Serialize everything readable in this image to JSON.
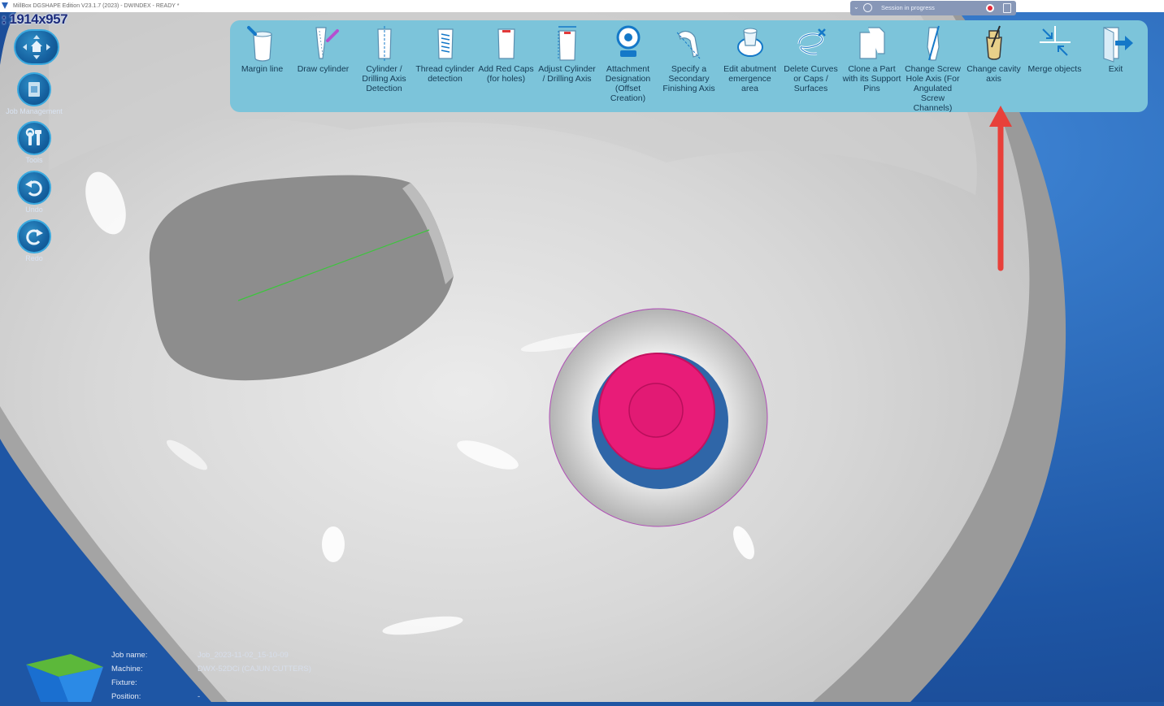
{
  "window": {
    "title": "MillBox DGSHAPE Edition V23.1.7 (2023) - DWINDEX - READY *",
    "resolution_badge": ": 1914x957"
  },
  "session": {
    "text": "Session in progress",
    "icons": [
      "chevron-down-icon",
      "session-icon",
      "record-icon",
      "exit-session-icon"
    ]
  },
  "left_panel": {
    "items": [
      {
        "label": "",
        "icon": "navigation-pad-icon"
      },
      {
        "label": "Job Management",
        "icon": "job-management-icon"
      },
      {
        "label": "Tools",
        "icon": "tools-icon"
      },
      {
        "label": "Undo",
        "icon": "undo-icon"
      },
      {
        "label": "Redo",
        "icon": "redo-icon"
      }
    ]
  },
  "toolbar": {
    "items": [
      {
        "label": "Margin line",
        "icon": "margin-line-icon"
      },
      {
        "label": "Draw cylinder",
        "icon": "draw-cylinder-icon"
      },
      {
        "label": "Cylinder / Drilling Axis Detection",
        "icon": "cylinder-detection-icon"
      },
      {
        "label": "Thread cylinder detection",
        "icon": "thread-cylinder-icon"
      },
      {
        "label": "Add Red Caps (for holes)",
        "icon": "red-caps-icon"
      },
      {
        "label": "Adjust Cylinder / Drilling Axis",
        "icon": "adjust-cylinder-icon"
      },
      {
        "label": "Attachment Designation (Offset Creation)",
        "icon": "attachment-icon"
      },
      {
        "label": "Specify a Secondary Finishing Axis",
        "icon": "secondary-axis-icon"
      },
      {
        "label": "Edit abutment emergence area",
        "icon": "abutment-icon"
      },
      {
        "label": "Delete Curves or Caps / Surfaces",
        "icon": "delete-curves-icon"
      },
      {
        "label": "Clone a Part with its Support Pins",
        "icon": "clone-part-icon"
      },
      {
        "label": "Change Screw Hole Axis (For Angulated Screw Channels)",
        "icon": "screw-hole-axis-icon"
      },
      {
        "label": "Change cavity axis",
        "icon": "cavity-axis-icon"
      },
      {
        "label": "Merge objects",
        "icon": "merge-objects-icon"
      },
      {
        "label": "Exit",
        "icon": "exit-icon"
      }
    ]
  },
  "annotation": {
    "icon": "red-arrow-icon",
    "color": "#e8403a"
  },
  "job_info": [
    {
      "key": "Job name:",
      "value": "Job_2023-11-02_15-10-09"
    },
    {
      "key": "Machine:",
      "value": "DWX-52DCi (CAJUN CUTTERS)"
    },
    {
      "key": "Fixture:",
      "value": ""
    },
    {
      "key": "Position:",
      "value": "-"
    }
  ],
  "colors": {
    "background": "#1f56a3",
    "toolbar": "#7cc4da",
    "model": "#d5d5d5",
    "cap": "#e81c78"
  }
}
